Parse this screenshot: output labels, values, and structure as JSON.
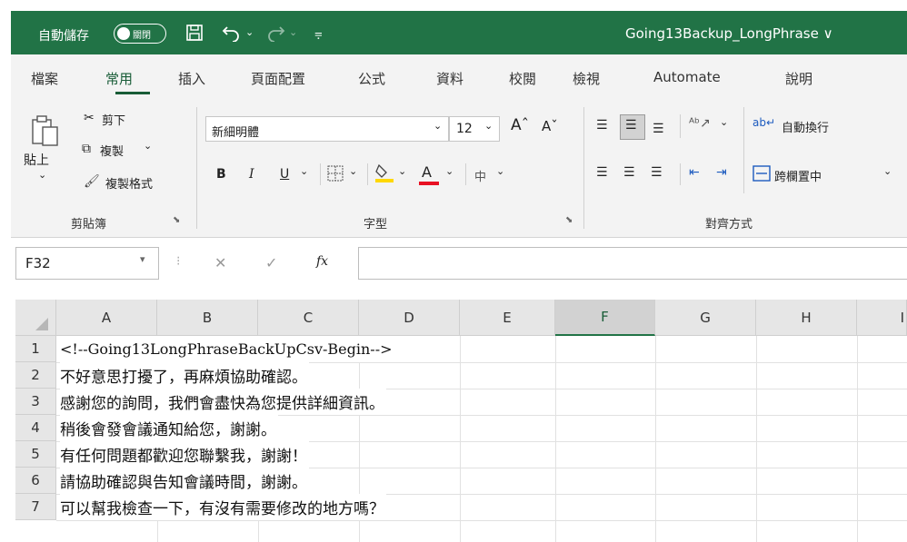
{
  "titlebar": {
    "autosave_label": "自動儲存",
    "autosave_state": "關閉",
    "save_icon": "save-icon",
    "undo_icon": "undo-icon",
    "redo_icon": "redo-icon",
    "doc_title": "Going13Backup_LongPhrase ∨",
    "accent_color": "#217346"
  },
  "tabs": [
    "檔案",
    "常用",
    "插入",
    "頁面配置",
    "公式",
    "資料",
    "校閱",
    "檢視",
    "Automate",
    "說明"
  ],
  "active_tab": "常用",
  "ribbon": {
    "clipboard": {
      "paste": "貼上",
      "cut": "剪下",
      "copy": "複製",
      "format_painter": "複製格式",
      "group_label": "剪貼簿"
    },
    "font": {
      "font_name": "新細明體",
      "font_size": "12",
      "bold": "B",
      "italic": "I",
      "underline": "U",
      "font_color_glyph": "A",
      "phonetic": "中",
      "group_label": "字型"
    },
    "alignment": {
      "wrap_text": "自動換行",
      "merge_center": "跨欄置中",
      "group_label": "對齊方式"
    }
  },
  "formula_bar": {
    "name_box": "F32",
    "fx_label": "fx",
    "value": ""
  },
  "columns": [
    "A",
    "B",
    "C",
    "D",
    "E",
    "F",
    "G",
    "H",
    "I"
  ],
  "selected_column": "F",
  "rows": [
    {
      "num": "1",
      "a": "<!--Going13LongPhraseBackUpCsv-Begin-->"
    },
    {
      "num": "2",
      "a": "不好意思打擾了，再麻煩協助確認。"
    },
    {
      "num": "3",
      "a": "感謝您的詢問，我們會盡快為您提供詳細資訊。"
    },
    {
      "num": "4",
      "a": "稍後會發會議通知給您，謝謝。"
    },
    {
      "num": "5",
      "a": "有任何問題都歡迎您聯繫我，謝謝！"
    },
    {
      "num": "6",
      "a": "請協助確認與告知會議時間，謝謝。"
    },
    {
      "num": "7",
      "a": "可以幫我檢查一下，有沒有需要修改的地方嗎？"
    }
  ]
}
